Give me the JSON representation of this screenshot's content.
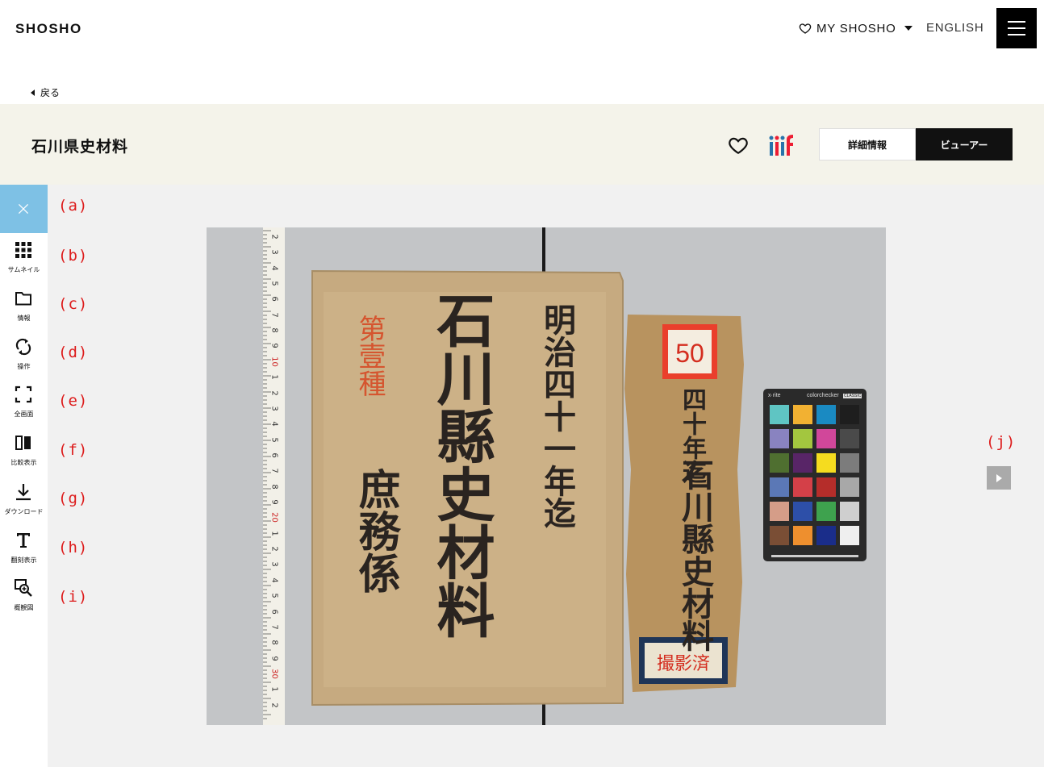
{
  "header": {
    "logo": "SHOSHO",
    "my_shosho": "MY SHOSHO",
    "language": "ENGLISH"
  },
  "nav": {
    "back_label": "戻る"
  },
  "record": {
    "title": "石川県史材料",
    "tabs": [
      {
        "label": "詳細情報",
        "active": false
      },
      {
        "label": "ビューアー",
        "active": true
      }
    ]
  },
  "toolbar": {
    "items": [
      {
        "label": "サムネイル",
        "icon": "grid-icon"
      },
      {
        "label": "情報",
        "icon": "folder-icon"
      },
      {
        "label": "操作",
        "icon": "rotate-icon"
      },
      {
        "label": "全画面",
        "icon": "fullscreen-icon"
      },
      {
        "label": "比較表示",
        "icon": "compare-icon"
      },
      {
        "label": "ダウンロード",
        "icon": "download-icon"
      },
      {
        "label": "翻刻表示",
        "icon": "text-icon"
      },
      {
        "label": "概観図",
        "icon": "zoom-icon"
      }
    ]
  },
  "markers": [
    "(a)",
    "(b)",
    "(c)",
    "(d)",
    "(e)",
    "(f)",
    "(g)",
    "(h)",
    "(i)",
    "(j)"
  ],
  "scan": {
    "left_cover": {
      "title": "石川縣史材料",
      "red_inscription": "第壹種",
      "side_text": "明治四十一年迄",
      "bottom_text": "庶務係"
    },
    "right_cover": {
      "number": "50",
      "year_text": "四十年迄",
      "title": "石川縣史材料",
      "stamp": "撮影済"
    },
    "ruler_numbers": [
      "2",
      "3",
      "4",
      "5",
      "6",
      "7",
      "8",
      "9",
      "10",
      "1",
      "2",
      "3",
      "4",
      "5",
      "6",
      "7",
      "8",
      "9",
      "20",
      "1",
      "2",
      "3",
      "4",
      "5",
      "6",
      "7",
      "8",
      "9",
      "30",
      "1",
      "2"
    ],
    "colorchecker": {
      "brand": "x·rite",
      "label": "colorchecker",
      "badge": "CLASSIC"
    }
  },
  "colors": {
    "accent_close": "#7ec1e5",
    "marker": "#dd1c1c",
    "band": "#f4f3ea"
  }
}
